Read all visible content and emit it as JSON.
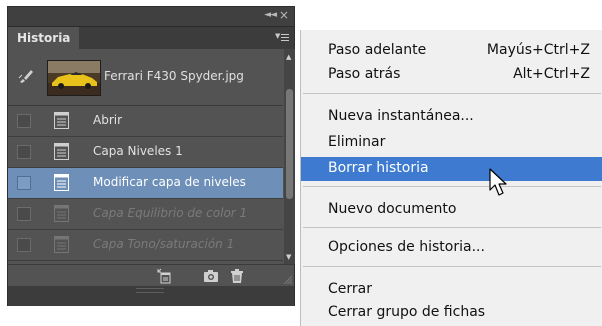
{
  "panel": {
    "tab_label": "Historia",
    "collapse_glyph": "◄◄",
    "close_glyph": "×",
    "snapshot": {
      "label": "Ferrari F430 Spyder.jpg",
      "thumbnail_icon": "car-photo-thumbnail"
    },
    "history_rows": [
      {
        "label": "Abrir",
        "state": "normal"
      },
      {
        "label": "Capa Niveles 1",
        "state": "normal"
      },
      {
        "label": "Modificar capa de niveles",
        "state": "active"
      },
      {
        "label": "Capa Equilibrio de color 1",
        "state": "dimmed"
      },
      {
        "label": "Capa Tono/saturación 1",
        "state": "dimmed"
      }
    ],
    "bottom_icons": [
      "new-document-from-state-icon",
      "camera-icon",
      "trash-icon"
    ]
  },
  "menu": {
    "items": [
      {
        "label": "Paso adelante",
        "shortcut": "Mayús+Ctrl+Z"
      },
      {
        "label": "Paso atrás",
        "shortcut": "Alt+Ctrl+Z"
      },
      {
        "label": "Nueva instantánea...",
        "shortcut": ""
      },
      {
        "label": "Eliminar",
        "shortcut": ""
      },
      {
        "label": "Borrar historia",
        "shortcut": "",
        "highlighted": true
      },
      {
        "label": "Nuevo documento",
        "shortcut": ""
      },
      {
        "label": "Opciones de historia...",
        "shortcut": ""
      },
      {
        "label": "Cerrar",
        "shortcut": ""
      },
      {
        "label": "Cerrar grupo de fichas",
        "shortcut": ""
      }
    ]
  },
  "colors": {
    "panel_bg": "#535353",
    "active_row": "#6d8fb8",
    "menu_bg": "#f0f0f0",
    "menu_highlight": "#3d7ad0",
    "thumbnail_car": "#e8c21a"
  }
}
